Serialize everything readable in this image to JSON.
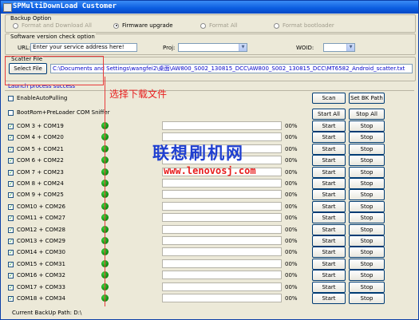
{
  "window": {
    "title": "SPMultiDownLoad Customer"
  },
  "backup": {
    "legend": "Backup Option",
    "options": [
      {
        "label": "Format and Download All",
        "selected": false,
        "enabled": false
      },
      {
        "label": "Firmware upgrade",
        "selected": true,
        "enabled": true
      },
      {
        "label": "Format All",
        "selected": false,
        "enabled": false
      },
      {
        "label": "Format bootloader",
        "selected": false,
        "enabled": false
      }
    ]
  },
  "version_check": {
    "legend": "Software version check option",
    "url_label": "URL:",
    "url_value": "Enter your service address here!",
    "proj_label": "Proj:",
    "woid_label": "WOID:"
  },
  "scatter": {
    "legend": "Scatter File",
    "select_label": "Select File",
    "path": "C:\\Documents and Settings\\wangfei2\\桌面\\AW800_S002_130815_DCC\\AW800_S002_130815_DCC\\MT6582_Android_scatter.txt"
  },
  "status_text": "Launch process success",
  "options": {
    "enable_auto_pulling": {
      "label": "EnableAutoPulling",
      "checked": false
    },
    "bootrom_preloader": {
      "label": "BootRom+PreLoader COM Sniffer",
      "checked": false
    }
  },
  "buttons": {
    "scan": "Scan",
    "set_bk_path": "Set BK Path",
    "start_all": "Start All",
    "stop_all": "Stop All"
  },
  "ports": [
    {
      "label": "COM 3 + COM19",
      "progress": 0,
      "pct": "00%",
      "start": "Start",
      "stop": "Stop"
    },
    {
      "label": "COM 4 + COM20",
      "progress": 0,
      "pct": "00%",
      "start": "Start",
      "stop": "Stop"
    },
    {
      "label": "COM 5 + COM21",
      "progress": 0,
      "pct": "00%",
      "start": "Start",
      "stop": "Stop"
    },
    {
      "label": "COM 6 + COM22",
      "progress": 0,
      "pct": "00%",
      "start": "Start",
      "stop": "Stop"
    },
    {
      "label": "COM 7 + COM23",
      "progress": 0,
      "pct": "00%",
      "start": "Start",
      "stop": "Stop"
    },
    {
      "label": "COM 8 + COM24",
      "progress": 0,
      "pct": "00%",
      "start": "Start",
      "stop": "Stop"
    },
    {
      "label": "COM 9 + COM25",
      "progress": 0,
      "pct": "00%",
      "start": "Start",
      "stop": "Stop"
    },
    {
      "label": "COM10 + COM26",
      "progress": 0,
      "pct": "00%",
      "start": "Start",
      "stop": "Stop"
    },
    {
      "label": "COM11 + COM27",
      "progress": 0,
      "pct": "00%",
      "start": "Start",
      "stop": "Stop"
    },
    {
      "label": "COM12 + COM28",
      "progress": 0,
      "pct": "00%",
      "start": "Start",
      "stop": "Stop"
    },
    {
      "label": "COM13 + COM29",
      "progress": 0,
      "pct": "00%",
      "start": "Start",
      "stop": "Stop"
    },
    {
      "label": "COM14 + COM30",
      "progress": 0,
      "pct": "00%",
      "start": "Start",
      "stop": "Stop"
    },
    {
      "label": "COM15 + COM31",
      "progress": 0,
      "pct": "00%",
      "start": "Start",
      "stop": "Stop"
    },
    {
      "label": "COM16 + COM32",
      "progress": 0,
      "pct": "00%",
      "start": "Start",
      "stop": "Stop"
    },
    {
      "label": "COM17 + COM33",
      "progress": 0,
      "pct": "00%",
      "start": "Start",
      "stop": "Stop"
    },
    {
      "label": "COM18 + COM34",
      "progress": 0,
      "pct": "00%",
      "start": "Start",
      "stop": "Stop"
    }
  ],
  "footer": {
    "label": "Current BackUp Path:",
    "value": "D:\\"
  },
  "annotation": {
    "text": "选择下载文件"
  },
  "watermark": {
    "site_name": "联想刷机网",
    "url": "www.lenovosj.com"
  },
  "colors": {
    "titlebar": "#0a5ce0",
    "path_text": "#0000c8",
    "status_text": "#0000d4",
    "led": "#0d850d",
    "annotation": "#e81e1e",
    "watermark_cn": "#1f3fd0"
  }
}
